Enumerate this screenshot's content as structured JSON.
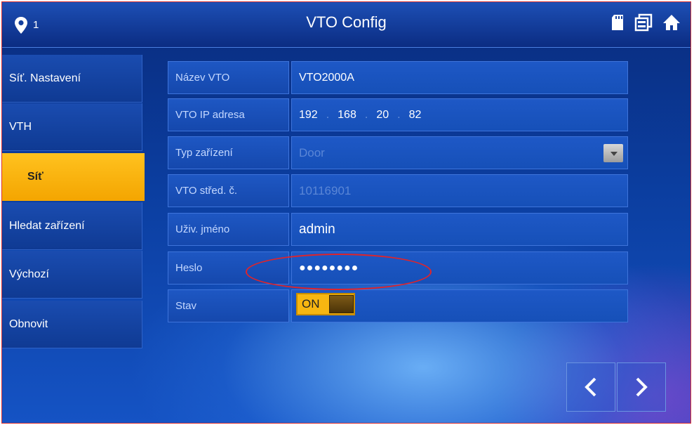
{
  "header": {
    "location_number": "1",
    "title": "VTO Config",
    "icons": [
      "location-pin-icon",
      "sd-card-icon",
      "copy-windows-icon",
      "home-icon"
    ]
  },
  "sidebar": {
    "items": [
      {
        "label": "Síť. Nastavení"
      },
      {
        "label": "VTH"
      },
      {
        "label": "Síť",
        "active": true
      },
      {
        "label": "Hledat zařízení"
      },
      {
        "label": "Výchozí"
      },
      {
        "label": "Obnovit"
      }
    ]
  },
  "form": {
    "vto_name": {
      "label": "Název VTO",
      "value": "VTO2000A"
    },
    "vto_ip": {
      "label": "VTO IP adresa",
      "octets": [
        "192",
        "168",
        "20",
        "82"
      ],
      "separator": "."
    },
    "device_type": {
      "label": "Typ zařízení",
      "value": "Door"
    },
    "vto_center": {
      "label": "VTO střed. č.",
      "value": "10116901"
    },
    "username": {
      "label": "Uživ. jméno",
      "value": "admin"
    },
    "password": {
      "label": "Heslo",
      "value": "●●●●●●●●"
    },
    "status": {
      "label": "Stav",
      "toggle_text": "ON"
    }
  },
  "nav": {
    "prev": "prev-arrow-icon",
    "next": "next-arrow-icon"
  },
  "colors": {
    "accent": "#f7b611",
    "highlight_circle": "#e0242a",
    "background": "#0b3ea0"
  }
}
